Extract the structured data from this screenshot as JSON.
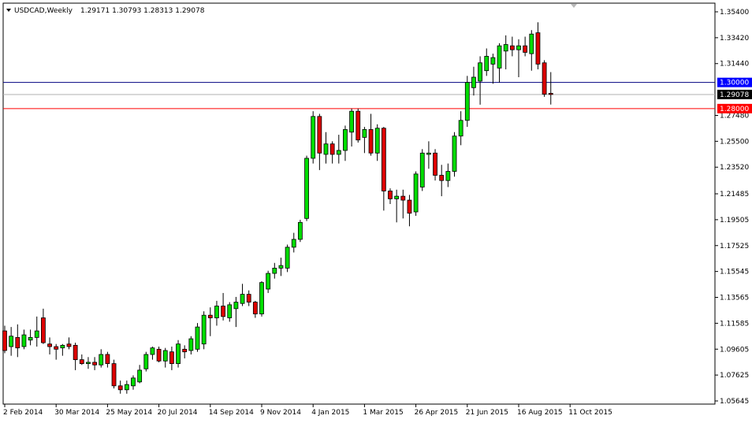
{
  "header": {
    "symbol": "USDCAD,Weekly",
    "ohlc": "1.29171 1.30793 1.28313 1.29078"
  },
  "colors": {
    "bull": "#00dd00",
    "bear": "#dd0000",
    "wick": "#000000",
    "line_blue": "#000080",
    "line_red": "#ff0000",
    "line_gray": "#b0b0b0",
    "badge_blue": "#0000ff",
    "badge_red": "#ff0000",
    "badge_black": "#000000"
  },
  "chart_data": {
    "type": "candlestick",
    "title": "USDCAD,Weekly",
    "ylim": [
      1.0565,
      1.356
    ],
    "y_ticks": [
      "1.35400",
      "1.33420",
      "1.31440",
      "1.27480",
      "1.25500",
      "1.23520",
      "1.21485",
      "1.19505",
      "1.17525",
      "1.15545",
      "1.13565",
      "1.11585",
      "1.09605",
      "1.07625",
      "1.05645"
    ],
    "x_labels": [
      "2 Feb 2014",
      "30 Mar 2014",
      "25 May 2014",
      "20 Jul 2014",
      "14 Sep 2014",
      "9 Nov 2014",
      "4 Jan 2015",
      "1 Mar 2015",
      "26 Apr 2015",
      "21 Jun 2015",
      "16 Aug 2015",
      "11 Oct 2015"
    ],
    "horizontal_lines": [
      {
        "value": 1.3,
        "label": "1.30000",
        "color": "blue"
      },
      {
        "value": 1.28,
        "label": "1.28000",
        "color": "red"
      },
      {
        "value": 1.29078,
        "label": "1.29078",
        "color": "gray"
      }
    ],
    "candles": [
      {
        "o": 1.11,
        "h": 1.114,
        "l": 1.093,
        "c": 1.095
      },
      {
        "o": 1.098,
        "h": 1.113,
        "l": 1.091,
        "c": 1.106
      },
      {
        "o": 1.105,
        "h": 1.115,
        "l": 1.09,
        "c": 1.097
      },
      {
        "o": 1.098,
        "h": 1.111,
        "l": 1.096,
        "c": 1.107
      },
      {
        "o": 1.103,
        "h": 1.111,
        "l": 1.099,
        "c": 1.105
      },
      {
        "o": 1.105,
        "h": 1.121,
        "l": 1.098,
        "c": 1.11
      },
      {
        "o": 1.12,
        "h": 1.127,
        "l": 1.1,
        "c": 1.101
      },
      {
        "o": 1.1,
        "h": 1.105,
        "l": 1.092,
        "c": 1.098
      },
      {
        "o": 1.098,
        "h": 1.1,
        "l": 1.088,
        "c": 1.096
      },
      {
        "o": 1.097,
        "h": 1.1,
        "l": 1.091,
        "c": 1.099
      },
      {
        "o": 1.1,
        "h": 1.105,
        "l": 1.096,
        "c": 1.098
      },
      {
        "o": 1.099,
        "h": 1.101,
        "l": 1.08,
        "c": 1.088
      },
      {
        "o": 1.088,
        "h": 1.092,
        "l": 1.084,
        "c": 1.085
      },
      {
        "o": 1.085,
        "h": 1.09,
        "l": 1.081,
        "c": 1.086
      },
      {
        "o": 1.086,
        "h": 1.09,
        "l": 1.08,
        "c": 1.084
      },
      {
        "o": 1.084,
        "h": 1.096,
        "l": 1.082,
        "c": 1.092
      },
      {
        "o": 1.092,
        "h": 1.094,
        "l": 1.082,
        "c": 1.085
      },
      {
        "o": 1.085,
        "h": 1.088,
        "l": 1.066,
        "c": 1.068
      },
      {
        "o": 1.068,
        "h": 1.072,
        "l": 1.062,
        "c": 1.065
      },
      {
        "o": 1.065,
        "h": 1.072,
        "l": 1.062,
        "c": 1.069
      },
      {
        "o": 1.068,
        "h": 1.076,
        "l": 1.065,
        "c": 1.074
      },
      {
        "o": 1.071,
        "h": 1.084,
        "l": 1.07,
        "c": 1.08
      },
      {
        "o": 1.081,
        "h": 1.094,
        "l": 1.079,
        "c": 1.092
      },
      {
        "o": 1.092,
        "h": 1.098,
        "l": 1.088,
        "c": 1.097
      },
      {
        "o": 1.096,
        "h": 1.098,
        "l": 1.086,
        "c": 1.087
      },
      {
        "o": 1.087,
        "h": 1.097,
        "l": 1.082,
        "c": 1.095
      },
      {
        "o": 1.094,
        "h": 1.098,
        "l": 1.08,
        "c": 1.085
      },
      {
        "o": 1.085,
        "h": 1.103,
        "l": 1.082,
        "c": 1.1
      },
      {
        "o": 1.096,
        "h": 1.099,
        "l": 1.089,
        "c": 1.094
      },
      {
        "o": 1.095,
        "h": 1.106,
        "l": 1.092,
        "c": 1.104
      },
      {
        "o": 1.096,
        "h": 1.116,
        "l": 1.094,
        "c": 1.113
      },
      {
        "o": 1.1,
        "h": 1.125,
        "l": 1.096,
        "c": 1.122
      },
      {
        "o": 1.122,
        "h": 1.128,
        "l": 1.106,
        "c": 1.12
      },
      {
        "o": 1.12,
        "h": 1.133,
        "l": 1.114,
        "c": 1.129
      },
      {
        "o": 1.129,
        "h": 1.139,
        "l": 1.118,
        "c": 1.121
      },
      {
        "o": 1.12,
        "h": 1.132,
        "l": 1.117,
        "c": 1.13
      },
      {
        "o": 1.127,
        "h": 1.136,
        "l": 1.113,
        "c": 1.132
      },
      {
        "o": 1.131,
        "h": 1.146,
        "l": 1.129,
        "c": 1.138
      },
      {
        "o": 1.138,
        "h": 1.141,
        "l": 1.129,
        "c": 1.132
      },
      {
        "o": 1.132,
        "h": 1.133,
        "l": 1.12,
        "c": 1.123
      },
      {
        "o": 1.123,
        "h": 1.148,
        "l": 1.121,
        "c": 1.147
      },
      {
        "o": 1.142,
        "h": 1.156,
        "l": 1.139,
        "c": 1.154
      },
      {
        "o": 1.154,
        "h": 1.162,
        "l": 1.15,
        "c": 1.158
      },
      {
        "o": 1.158,
        "h": 1.166,
        "l": 1.152,
        "c": 1.16
      },
      {
        "o": 1.158,
        "h": 1.176,
        "l": 1.155,
        "c": 1.174
      },
      {
        "o": 1.174,
        "h": 1.185,
        "l": 1.17,
        "c": 1.18
      },
      {
        "o": 1.18,
        "h": 1.195,
        "l": 1.178,
        "c": 1.193
      },
      {
        "o": 1.196,
        "h": 1.244,
        "l": 1.194,
        "c": 1.242
      },
      {
        "o": 1.242,
        "h": 1.278,
        "l": 1.238,
        "c": 1.274
      },
      {
        "o": 1.274,
        "h": 1.276,
        "l": 1.233,
        "c": 1.246
      },
      {
        "o": 1.245,
        "h": 1.262,
        "l": 1.238,
        "c": 1.253
      },
      {
        "o": 1.253,
        "h": 1.255,
        "l": 1.238,
        "c": 1.245
      },
      {
        "o": 1.245,
        "h": 1.26,
        "l": 1.238,
        "c": 1.248
      },
      {
        "o": 1.248,
        "h": 1.267,
        "l": 1.24,
        "c": 1.264
      },
      {
        "o": 1.262,
        "h": 1.28,
        "l": 1.251,
        "c": 1.278
      },
      {
        "o": 1.278,
        "h": 1.28,
        "l": 1.254,
        "c": 1.256
      },
      {
        "o": 1.258,
        "h": 1.266,
        "l": 1.246,
        "c": 1.264
      },
      {
        "o": 1.264,
        "h": 1.276,
        "l": 1.244,
        "c": 1.246
      },
      {
        "o": 1.246,
        "h": 1.268,
        "l": 1.24,
        "c": 1.265
      },
      {
        "o": 1.265,
        "h": 1.266,
        "l": 1.202,
        "c": 1.217
      },
      {
        "o": 1.217,
        "h": 1.219,
        "l": 1.207,
        "c": 1.211
      },
      {
        "o": 1.211,
        "h": 1.218,
        "l": 1.193,
        "c": 1.213
      },
      {
        "o": 1.213,
        "h": 1.218,
        "l": 1.196,
        "c": 1.21
      },
      {
        "o": 1.21,
        "h": 1.214,
        "l": 1.19,
        "c": 1.2
      },
      {
        "o": 1.201,
        "h": 1.232,
        "l": 1.198,
        "c": 1.23
      },
      {
        "o": 1.22,
        "h": 1.249,
        "l": 1.217,
        "c": 1.246
      },
      {
        "o": 1.245,
        "h": 1.255,
        "l": 1.234,
        "c": 1.246
      },
      {
        "o": 1.246,
        "h": 1.249,
        "l": 1.225,
        "c": 1.229
      },
      {
        "o": 1.229,
        "h": 1.237,
        "l": 1.213,
        "c": 1.225
      },
      {
        "o": 1.225,
        "h": 1.238,
        "l": 1.22,
        "c": 1.232
      },
      {
        "o": 1.232,
        "h": 1.262,
        "l": 1.228,
        "c": 1.259
      },
      {
        "o": 1.259,
        "h": 1.278,
        "l": 1.252,
        "c": 1.271
      },
      {
        "o": 1.271,
        "h": 1.305,
        "l": 1.266,
        "c": 1.3
      },
      {
        "o": 1.296,
        "h": 1.312,
        "l": 1.29,
        "c": 1.304
      },
      {
        "o": 1.301,
        "h": 1.32,
        "l": 1.283,
        "c": 1.315
      },
      {
        "o": 1.309,
        "h": 1.326,
        "l": 1.305,
        "c": 1.32
      },
      {
        "o": 1.314,
        "h": 1.322,
        "l": 1.299,
        "c": 1.319
      },
      {
        "o": 1.311,
        "h": 1.33,
        "l": 1.3,
        "c": 1.328
      },
      {
        "o": 1.324,
        "h": 1.336,
        "l": 1.31,
        "c": 1.329
      },
      {
        "o": 1.328,
        "h": 1.335,
        "l": 1.32,
        "c": 1.325
      },
      {
        "o": 1.325,
        "h": 1.333,
        "l": 1.304,
        "c": 1.328
      },
      {
        "o": 1.328,
        "h": 1.335,
        "l": 1.32,
        "c": 1.323
      },
      {
        "o": 1.322,
        "h": 1.34,
        "l": 1.309,
        "c": 1.337
      },
      {
        "o": 1.338,
        "h": 1.346,
        "l": 1.31,
        "c": 1.314
      },
      {
        "o": 1.315,
        "h": 1.317,
        "l": 1.289,
        "c": 1.291
      },
      {
        "o": 1.2917,
        "h": 1.3079,
        "l": 1.2831,
        "c": 1.2908
      }
    ]
  }
}
